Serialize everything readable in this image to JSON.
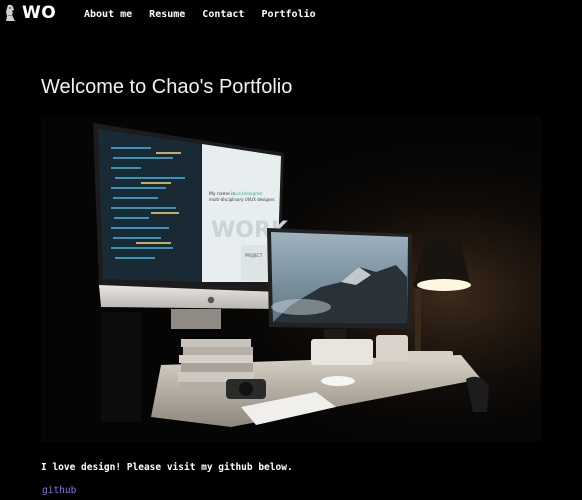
{
  "header": {
    "logo_text": "WO",
    "logo_icon": "statue-icon"
  },
  "nav": {
    "items": [
      {
        "label": "About me"
      },
      {
        "label": "Resume"
      },
      {
        "label": "Contact"
      },
      {
        "label": "Portfolio"
      }
    ]
  },
  "main": {
    "title": "Welcome to Chao's Portfolio",
    "hero_image": "desk-setup-photo",
    "screen_text": {
      "headline": "My name is",
      "highlight": "(un)designer",
      "rest": "multi-disciplinary UI/UX designer.",
      "big": "WORK",
      "project": "PROJECT"
    },
    "description": "I love design! Please visit my github below.",
    "github_link": "github"
  },
  "colors": {
    "background": "#000000",
    "text": "#ffffff",
    "link": "#8b6cff"
  }
}
